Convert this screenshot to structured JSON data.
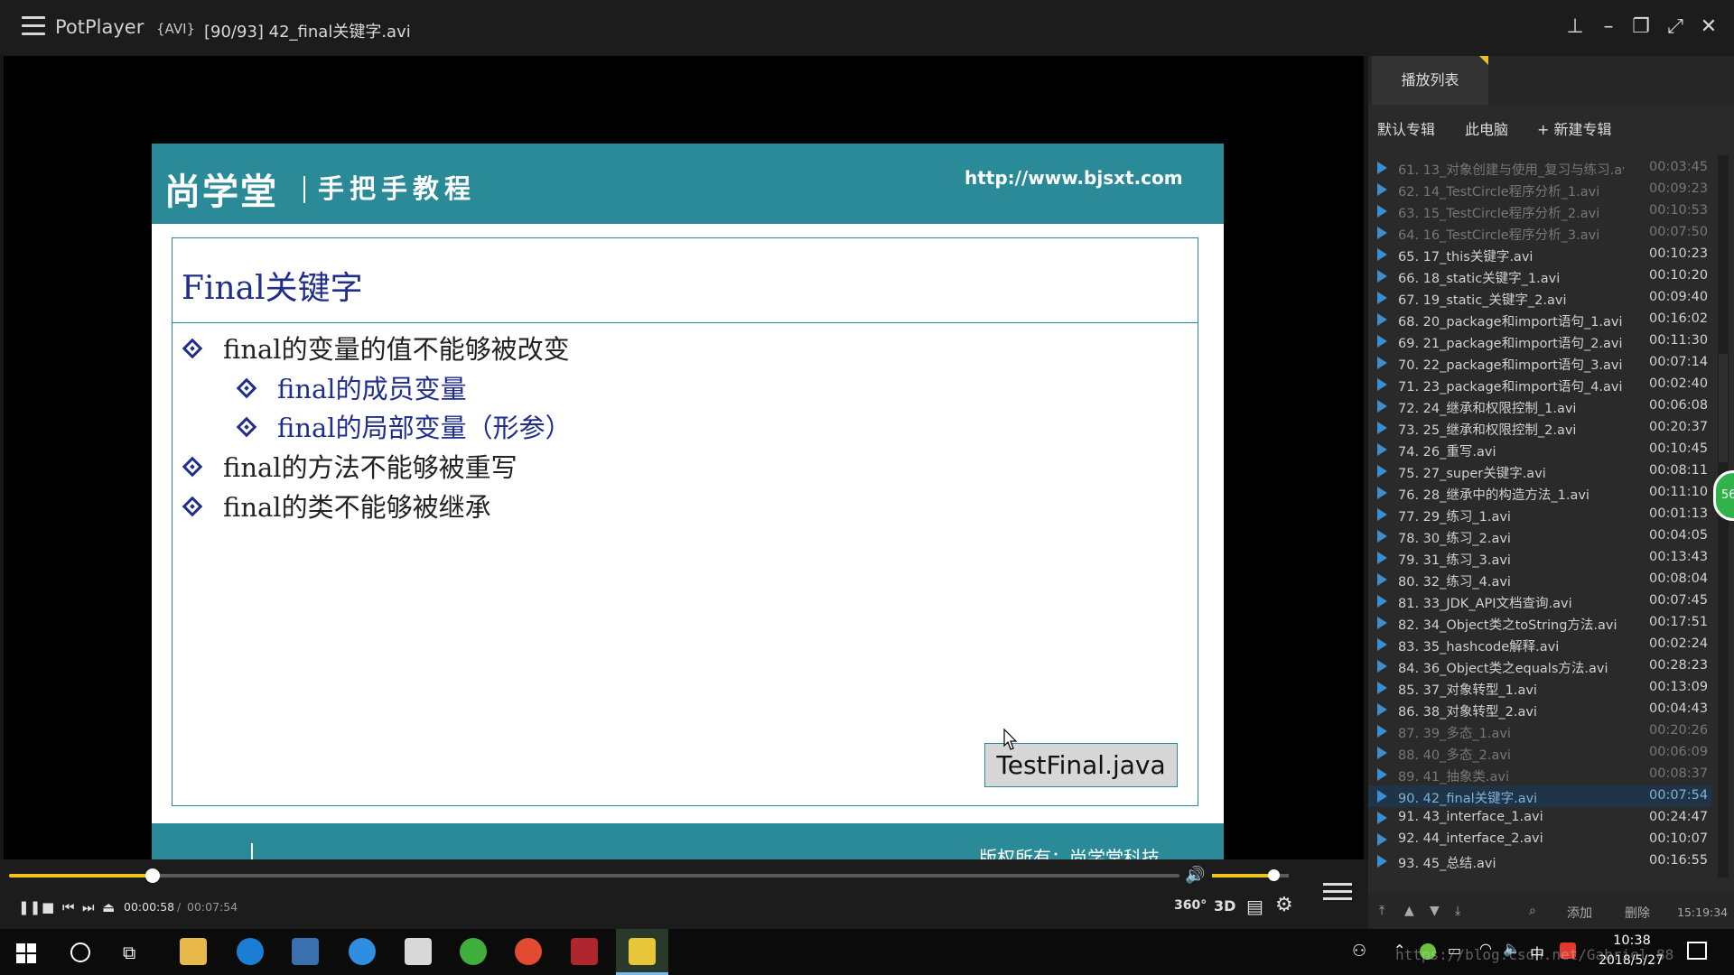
{
  "titlebar": {
    "app_name": "PotPlayer",
    "format": "{AVI}",
    "file_title": "[90/93] 42_final关键字.avi"
  },
  "slide": {
    "logo": "尚学堂",
    "tagline": "手把手教程",
    "url": "http://www.bjsxt.com",
    "title": "Final关键字",
    "bullets": [
      "final的变量的值不能够被改变",
      "final的成员变量",
      "final的局部变量（形参）",
      "final的方法不能够被重写",
      "final的类不能够被继承"
    ],
    "button": "TestFinal.java",
    "copyright": "版权所有：尚学堂科技"
  },
  "playlist": {
    "tab": "播放列表",
    "albums": [
      "默认专辑",
      "此电脑",
      "+ 新建专辑"
    ],
    "items": [
      {
        "name": "61. 13_对象创建与使用_复习与练习.avi",
        "dur": "00:03:45",
        "state": "dim"
      },
      {
        "name": "62. 14_TestCircle程序分析_1.avi",
        "dur": "00:09:23",
        "state": "dim"
      },
      {
        "name": "63. 15_TestCircle程序分析_2.avi",
        "dur": "00:10:53",
        "state": "dim"
      },
      {
        "name": "64. 16_TestCircle程序分析_3.avi",
        "dur": "00:07:50",
        "state": "dim"
      },
      {
        "name": "65. 17_this关键字.avi",
        "dur": "00:10:23",
        "state": ""
      },
      {
        "name": "66. 18_static关键字_1.avi",
        "dur": "00:10:20",
        "state": ""
      },
      {
        "name": "67. 19_static_关键字_2.avi",
        "dur": "00:09:40",
        "state": ""
      },
      {
        "name": "68. 20_package和import语句_1.avi",
        "dur": "00:16:02",
        "state": ""
      },
      {
        "name": "69. 21_package和import语句_2.avi",
        "dur": "00:11:30",
        "state": ""
      },
      {
        "name": "70. 22_package和import语句_3.avi",
        "dur": "00:07:14",
        "state": ""
      },
      {
        "name": "71. 23_package和import语句_4.avi",
        "dur": "00:02:40",
        "state": ""
      },
      {
        "name": "72. 24_继承和权限控制_1.avi",
        "dur": "00:06:08",
        "state": ""
      },
      {
        "name": "73. 25_继承和权限控制_2.avi",
        "dur": "00:20:37",
        "state": ""
      },
      {
        "name": "74. 26_重写.avi",
        "dur": "00:10:45",
        "state": ""
      },
      {
        "name": "75. 27_super关键字.avi",
        "dur": "00:08:11",
        "state": ""
      },
      {
        "name": "76. 28_继承中的构造方法_1.avi",
        "dur": "00:11:10",
        "state": ""
      },
      {
        "name": "77. 29_练习_1.avi",
        "dur": "00:01:13",
        "state": ""
      },
      {
        "name": "78. 30_练习_2.avi",
        "dur": "00:04:05",
        "state": ""
      },
      {
        "name": "79. 31_练习_3.avi",
        "dur": "00:13:43",
        "state": ""
      },
      {
        "name": "80. 32_练习_4.avi",
        "dur": "00:08:04",
        "state": ""
      },
      {
        "name": "81. 33_JDK_API文档查询.avi",
        "dur": "00:07:45",
        "state": ""
      },
      {
        "name": "82. 34_Object类之toString方法.avi",
        "dur": "00:17:51",
        "state": ""
      },
      {
        "name": "83. 35_hashcode解释.avi",
        "dur": "00:02:24",
        "state": ""
      },
      {
        "name": "84. 36_Object类之equals方法.avi",
        "dur": "00:28:23",
        "state": ""
      },
      {
        "name": "85. 37_对象转型_1.avi",
        "dur": "00:13:09",
        "state": ""
      },
      {
        "name": "86. 38_对象转型_2.avi",
        "dur": "00:04:43",
        "state": ""
      },
      {
        "name": "87. 39_多态_1.avi",
        "dur": "00:20:26",
        "state": "dim"
      },
      {
        "name": "88. 40_多态_2.avi",
        "dur": "00:06:09",
        "state": "dim"
      },
      {
        "name": "89. 41_抽象类.avi",
        "dur": "00:08:37",
        "state": "dim"
      },
      {
        "name": "90. 42_final关键字.avi",
        "dur": "00:07:54",
        "state": "active"
      },
      {
        "name": "91. 43_interface_1.avi",
        "dur": "00:24:47",
        "state": ""
      },
      {
        "name": "92. 44_interface_2.avi",
        "dur": "00:10:07",
        "state": ""
      },
      {
        "name": "93. 45_总结.avi",
        "dur": "00:16:55",
        "state": ""
      }
    ],
    "bottom_add": "添加",
    "bottom_delete": "删除",
    "bottom_time": "15:19:34",
    "bubble": "56"
  },
  "controls": {
    "current_time": "00:00:58",
    "separator": "/",
    "total_time": "00:07:54",
    "progress": 0.123,
    "volume": 0.8,
    "btn_360": "360°",
    "btn_3d": "3D"
  },
  "taskbar": {
    "ime": "中",
    "time": "10:38",
    "date": "2018/5/27",
    "watermark": "https://blog.csdn.net/Gabriel_88"
  },
  "colors": {
    "accent": "#f0c419",
    "slide_teal": "#2b8a97",
    "slide_blue": "#1f2d8c",
    "playlist_play": "#3c8fd0"
  }
}
